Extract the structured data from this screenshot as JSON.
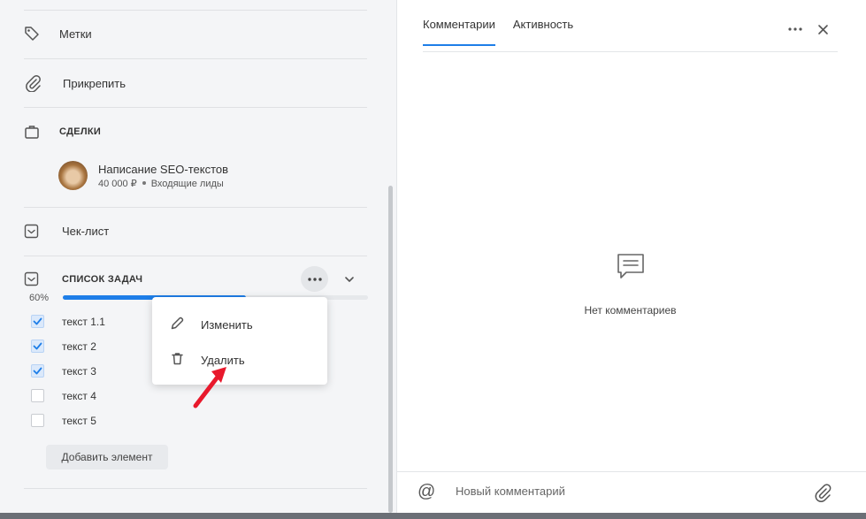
{
  "left_panel": {
    "tags_label": "Метки",
    "attach_label": "Прикрепить",
    "deals_header": "СДЕЛКИ",
    "deal": {
      "title": "Написание SEO-текстов",
      "amount": "40 000 ₽",
      "stage": "Входящие лиды"
    },
    "checklist_label": "Чек-лист",
    "task_list": {
      "header": "СПИСОК ЗАДАЧ",
      "progress_text": "60%",
      "progress_value": 0.6,
      "items": [
        {
          "label": "текст 1.1",
          "checked": true
        },
        {
          "label": "текст 2",
          "checked": true
        },
        {
          "label": "текст 3",
          "checked": true
        },
        {
          "label": "текст 4",
          "checked": false
        },
        {
          "label": "текст 5",
          "checked": false
        }
      ],
      "add_button": "Добавить элемент"
    }
  },
  "context_menu": {
    "edit_label": "Изменить",
    "delete_label": "Удалить"
  },
  "right_panel": {
    "tabs": [
      {
        "label": "Комментарии",
        "active": true
      },
      {
        "label": "Активность",
        "active": false
      }
    ],
    "empty_text": "Нет комментариев",
    "composer": {
      "at_symbol": "@",
      "placeholder": "Новый комментарий"
    }
  },
  "colors": {
    "accent": "#1e7ee8",
    "panel_bg": "#f4f5f7",
    "arrow": "#e8192c"
  },
  "icons": [
    "tag-icon",
    "paperclip-icon",
    "briefcase-icon",
    "checklist-icon",
    "more-dots-icon",
    "chevron-down-icon",
    "check-icon",
    "pencil-icon",
    "trash-icon",
    "comment-icon",
    "close-icon",
    "at-icon",
    "attach-icon",
    "red-arrow"
  ]
}
